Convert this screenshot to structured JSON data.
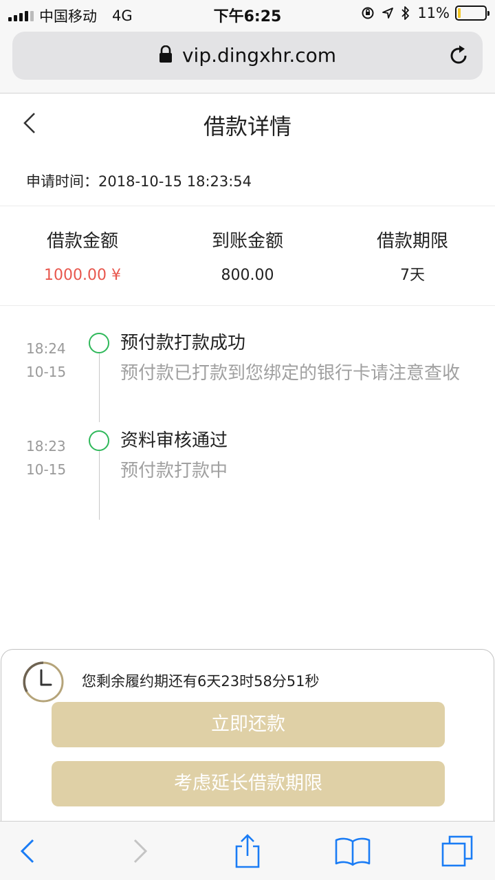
{
  "status_bar": {
    "carrier": "中国移动",
    "network": "4G",
    "time": "下午6:25",
    "battery": "11%",
    "battery_level": 0.11
  },
  "browser": {
    "url": "vip.dingxhr.com"
  },
  "header": {
    "title": "借款详情"
  },
  "apply_time": {
    "label": "申请时间：",
    "value": "2018-10-15 18:23:54"
  },
  "summary": {
    "items": [
      {
        "label": "借款金额",
        "value": "1000.00 ¥",
        "color": "#e8574d"
      },
      {
        "label": "到账金额",
        "value": "800.00"
      },
      {
        "label": "借款期限",
        "value": "7天"
      }
    ]
  },
  "timeline": {
    "events": [
      {
        "time": "18:24",
        "date": "10-15",
        "title": "预付款打款成功",
        "desc": "预付款已打款到您绑定的银行卡请注意查收"
      },
      {
        "time": "18:23",
        "date": "10-15",
        "title": "资料审核通过",
        "desc": "预付款打款中"
      }
    ],
    "dot_color": "#2fb85a"
  },
  "bottom_panel": {
    "countdown": "您剩余履约期还有6天23时58分51秒",
    "repay_label": "立即还款",
    "extend_label": "考虑延长借款期限",
    "button_color": "#dfd0a6"
  }
}
